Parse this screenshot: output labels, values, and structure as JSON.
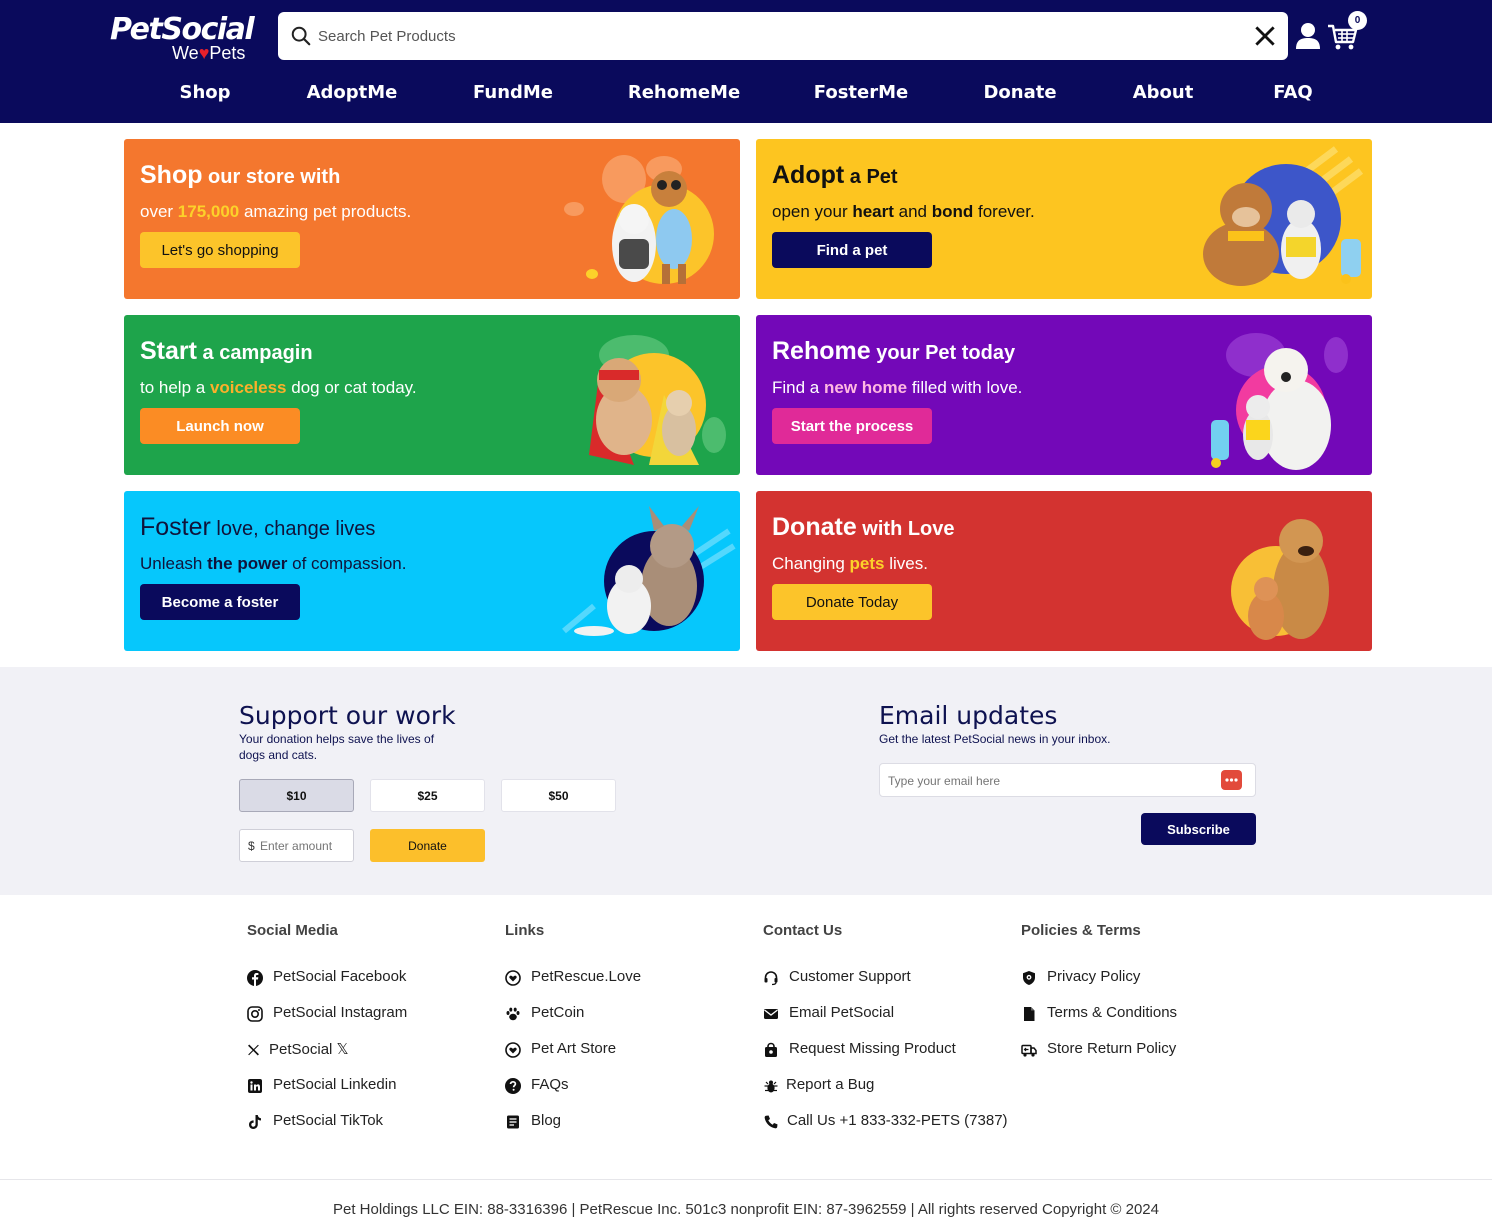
{
  "header": {
    "logo_text": "PetSocial",
    "logo_tagline_left": "We",
    "logo_tagline_right": "Pets",
    "search_placeholder": "Search Pet Products",
    "cart_count": "0",
    "nav": [
      "Shop",
      "AdoptMe",
      "FundMe",
      "RehomeMe",
      "FosterMe",
      "Donate",
      "About",
      "FAQ"
    ]
  },
  "cards": {
    "shop": {
      "title_bold": "Shop",
      "title_rest": " our store with",
      "sub_pre": "over ",
      "sub_hl": "175,000",
      "sub_post": " amazing pet products.",
      "button": "Let's go shopping"
    },
    "adopt": {
      "title_bold": "Adopt",
      "title_rest": " a Pet",
      "sub_pre": "open your ",
      "sub_hl": "heart",
      "sub_mid": " and ",
      "sub_hl2": "bond",
      "sub_post": " forever.",
      "button": "Find a pet"
    },
    "campaign": {
      "title_bold": "Start",
      "title_rest": " a campagin",
      "sub_pre": "to help a ",
      "sub_hl": "voiceless",
      "sub_post": " dog or cat today.",
      "button": "Launch now"
    },
    "rehome": {
      "title_bold": "Rehome",
      "title_rest": " your Pet today",
      "sub_pre": "Find a ",
      "sub_hl": "new home",
      "sub_post": " filled with love.",
      "button": "Start the process"
    },
    "foster": {
      "title_bold": "Foster",
      "title_rest": " love, change lives",
      "sub_pre": "Unleash ",
      "sub_hl": "the power",
      "sub_post": " of compassion.",
      "button": "Become a foster"
    },
    "donate": {
      "title_bold": "Donate",
      "title_rest": " with Love",
      "sub_pre": "Changing ",
      "sub_hl": "pets",
      "sub_post": " lives.",
      "button": "Donate Today"
    }
  },
  "support": {
    "title": "Support our work",
    "subtitle_line1": "Your donation helps save the lives of",
    "subtitle_line2": "dogs and cats.",
    "amounts": [
      "$10",
      "$25",
      "$50"
    ],
    "selected_amount": "$10",
    "currency": "$",
    "amount_placeholder": "Enter amount",
    "donate_button": "Donate"
  },
  "email": {
    "title": "Email updates",
    "subtitle": "Get the latest PetSocial news in your inbox.",
    "placeholder": "Type your email here",
    "button": "Subscribe"
  },
  "footer": {
    "columns": [
      {
        "title": "Social Media",
        "links": [
          {
            "label": "PetSocial Facebook",
            "icon": "facebook-icon"
          },
          {
            "label": "PetSocial Instagram",
            "icon": "instagram-icon"
          },
          {
            "label": "PetSocial 𝕏",
            "icon": "x-icon"
          },
          {
            "label": "PetSocial Linkedin",
            "icon": "linkedin-icon"
          },
          {
            "label": "PetSocial TikTok",
            "icon": "tiktok-icon"
          }
        ]
      },
      {
        "title": "Links",
        "links": [
          {
            "label": "PetRescue.Love",
            "icon": "heart-circle-icon"
          },
          {
            "label": "PetCoin",
            "icon": "paw-icon"
          },
          {
            "label": "Pet Art Store",
            "icon": "heart-circle-icon"
          },
          {
            "label": "FAQs",
            "icon": "question-icon"
          },
          {
            "label": "Blog",
            "icon": "blog-icon"
          }
        ]
      },
      {
        "title": "Contact Us",
        "links": [
          {
            "label": "Customer Support",
            "icon": "headset-icon"
          },
          {
            "label": "Email PetSocial",
            "icon": "envelope-icon"
          },
          {
            "label": "Request Missing Product",
            "icon": "bag-icon"
          },
          {
            "label": "Report a Bug",
            "icon": "bug-icon"
          },
          {
            "label": "Call Us +1 833-332-PETS (7387)",
            "icon": "phone-icon"
          }
        ]
      },
      {
        "title": "Policies & Terms",
        "links": [
          {
            "label": "Privacy Policy",
            "icon": "shield-icon"
          },
          {
            "label": "Terms & Conditions",
            "icon": "document-icon"
          },
          {
            "label": "Store Return Policy",
            "icon": "return-truck-icon"
          }
        ]
      }
    ],
    "legal": "Pet Holdings LLC EIN: 88-3316396  | PetRescue Inc. 501c3 nonprofit EIN: 87-3962559  | All rights reserved Copyright © 2024"
  },
  "colors": {
    "navy": "#0a0a5c",
    "shop_card": "#f4772e",
    "adopt_card": "#fdc520",
    "campaign_card": "#1ea44b",
    "rehome_card": "#7308b8",
    "foster_card": "#06c7fc",
    "donate_card": "#d33330",
    "accent_yellow": "#fcbf2b"
  }
}
